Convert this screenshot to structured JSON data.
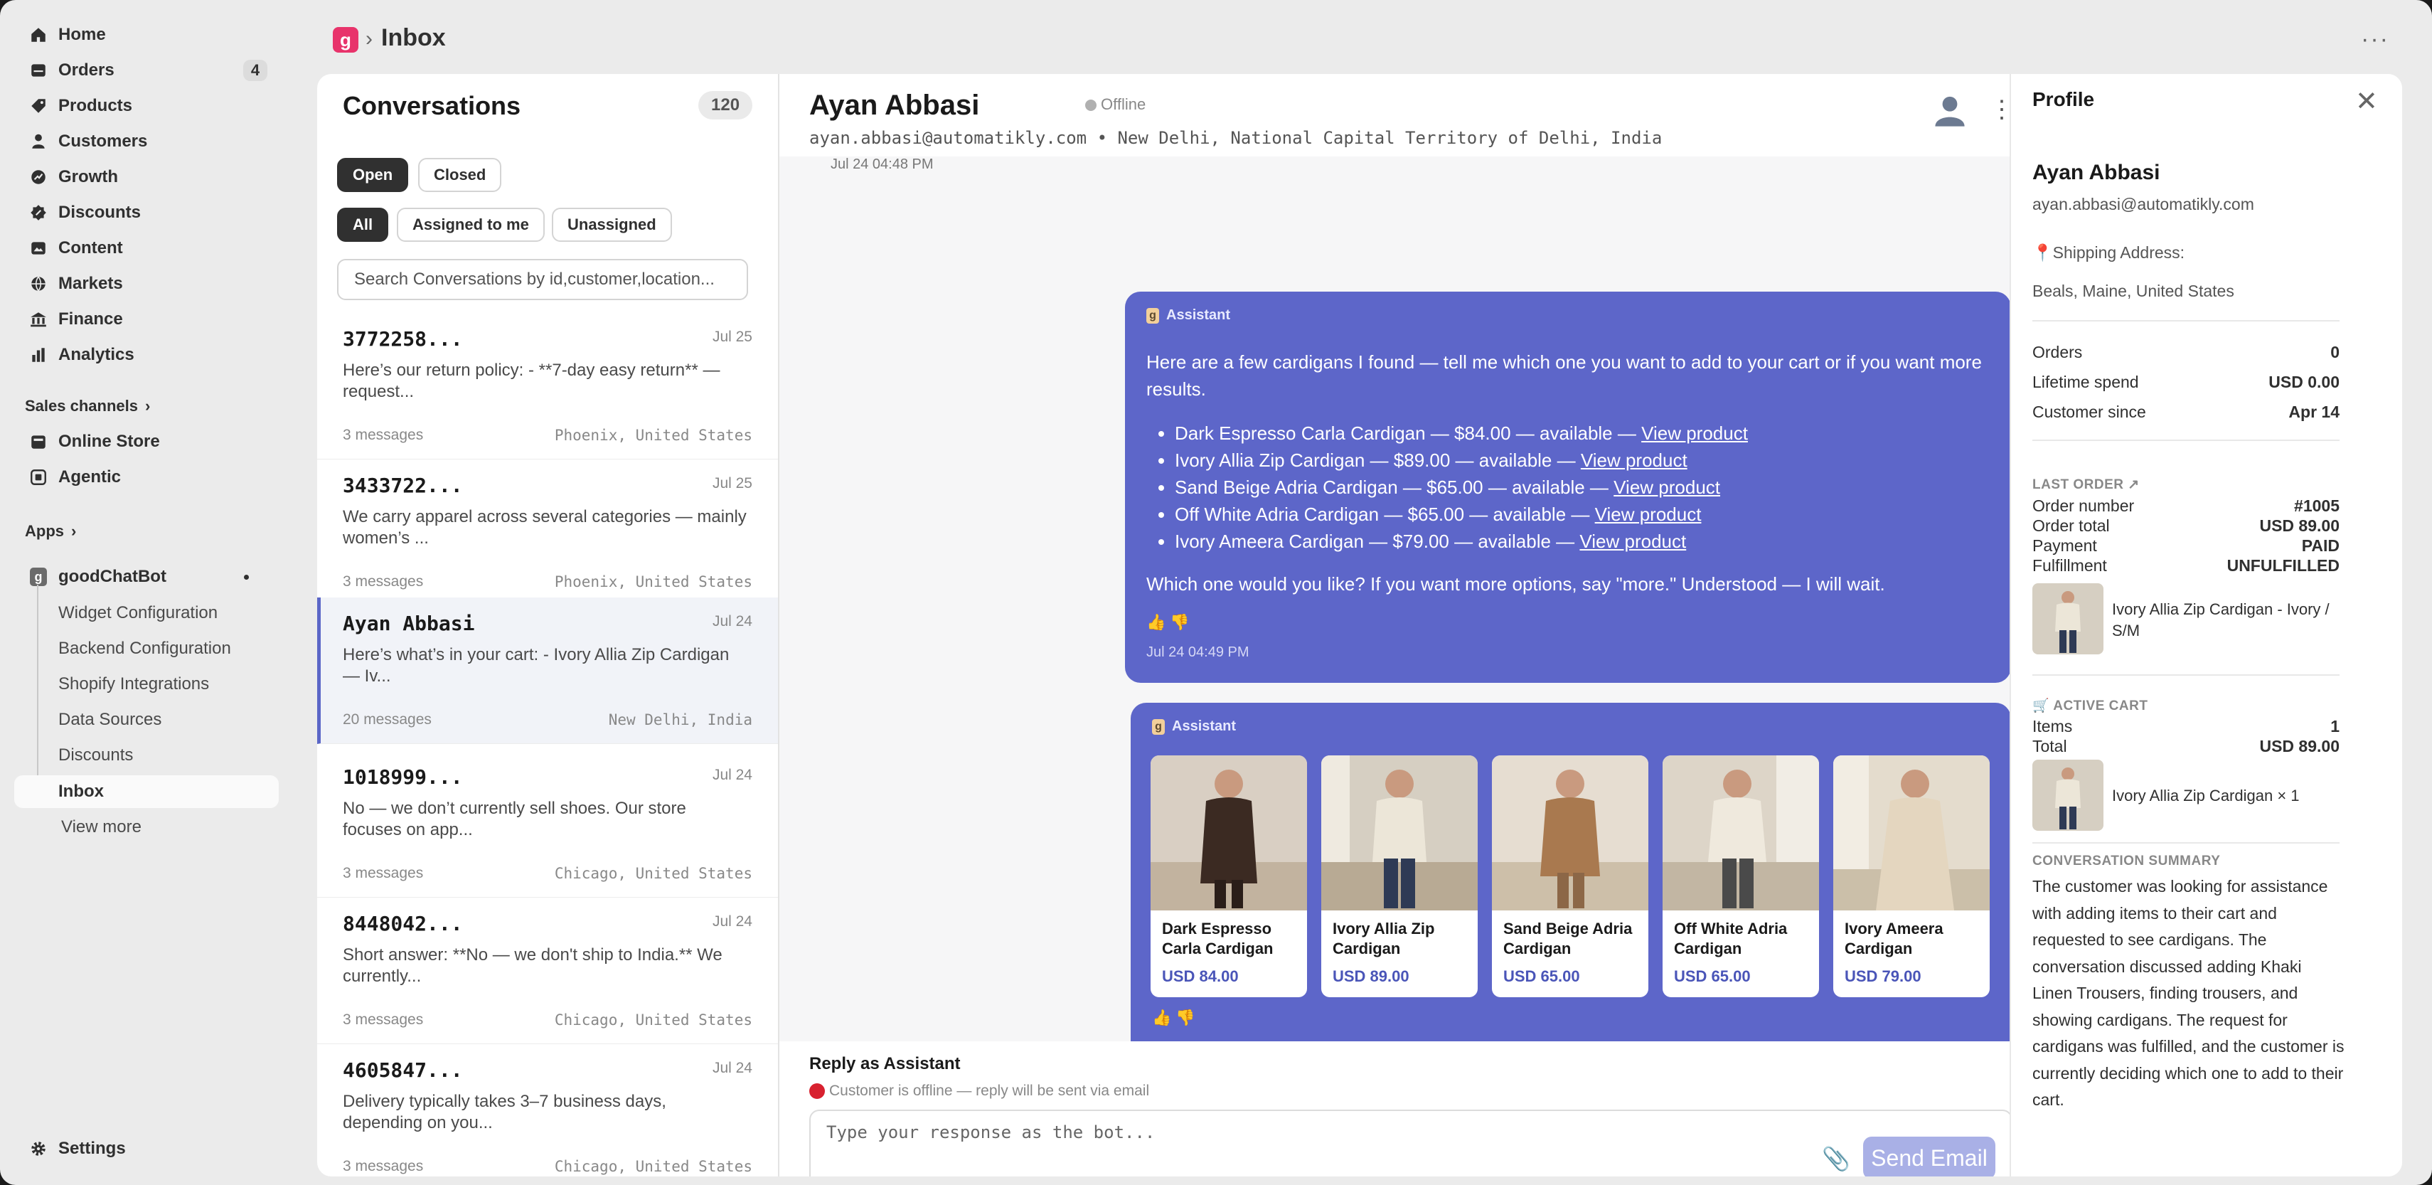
{
  "sidebar": {
    "nav": [
      {
        "label": "Home",
        "icon": "home-icon"
      },
      {
        "label": "Orders",
        "icon": "orders-icon",
        "badge": "4"
      },
      {
        "label": "Products",
        "icon": "tag-icon"
      },
      {
        "label": "Customers",
        "icon": "person-icon"
      },
      {
        "label": "Growth",
        "icon": "growth-icon"
      },
      {
        "label": "Discounts",
        "icon": "discount-icon"
      },
      {
        "label": "Content",
        "icon": "content-icon"
      },
      {
        "label": "Markets",
        "icon": "globe-icon"
      },
      {
        "label": "Finance",
        "icon": "bank-icon"
      },
      {
        "label": "Analytics",
        "icon": "bar-chart-icon"
      }
    ],
    "sales_channels_label": "Sales channels",
    "channels": [
      {
        "label": "Online Store",
        "icon": "store-icon"
      },
      {
        "label": "Agentic",
        "icon": "agentic-icon"
      }
    ],
    "apps_label": "Apps",
    "app_name": "goodChatBot",
    "app_sub": [
      "Widget Configuration",
      "Backend Configuration",
      "Shopify Integrations",
      "Data Sources",
      "Discounts",
      "Inbox"
    ],
    "view_more": "View more",
    "settings": "Settings"
  },
  "topbar": {
    "brand": "g",
    "separator": "›",
    "title": "Inbox",
    "more": "···"
  },
  "conversations": {
    "title": "Conversations",
    "count": "120",
    "status_filters": [
      "Open",
      "Closed"
    ],
    "assign_filters": [
      "All",
      "Assigned to me",
      "Unassigned"
    ],
    "search_placeholder": "Search Conversations by id,customer,location...",
    "items": [
      {
        "id": "3772258...",
        "date": "Jul 25",
        "text": "Here’s our return policy: - **7-day easy return** — request...",
        "count": "3 messages",
        "loc": "Phoenix, United States"
      },
      {
        "id": "3433722...",
        "date": "Jul 25",
        "text": "We carry apparel across several categories — mainly women’s ...",
        "count": "3 messages",
        "loc": "Phoenix, United States"
      },
      {
        "id": "Ayan Abbasi",
        "date": "Jul 24",
        "text": "Here’s what’s in your cart: - Ivory Allia Zip Cardigan — Iv...",
        "count": "20 messages",
        "loc": "New Delhi, India"
      },
      {
        "id": "1018999...",
        "date": "Jul 24",
        "text": "No — we don’t currently sell shoes. Our store focuses on app...",
        "count": "3 messages",
        "loc": "Chicago, United States"
      },
      {
        "id": "8448042...",
        "date": "Jul 24",
        "text": "Short answer: **No — we don't ship to India.** We currently...",
        "count": "3 messages",
        "loc": "Chicago, United States"
      },
      {
        "id": "4605847...",
        "date": "Jul 24",
        "text": "Delivery typically takes 3–7 business days, depending on you...",
        "count": "3 messages",
        "loc": "Chicago, United States"
      }
    ]
  },
  "chat": {
    "name": "Ayan Abbasi",
    "status": "Offline",
    "subtitle": "ayan.abbasi@automatikly.com • New Delhi, National Capital Territory of Delhi, India",
    "top_timestamp": "Jul 24 04:48 PM",
    "msg1": {
      "sender": "Assistant",
      "intro": "Here are a few cardigans I found — tell me which one you want to add to your cart or if you want more results.",
      "items": [
        {
          "text": "Dark Espresso Carla Cardigan — $84.00 — available — ",
          "link": "View product"
        },
        {
          "text": "Ivory Allia Zip Cardigan — $89.00 — available — ",
          "link": "View product"
        },
        {
          "text": "Sand Beige Adria Cardigan — $65.00 — available — ",
          "link": "View product"
        },
        {
          "text": "Off White Adria Cardigan — $65.00 — available — ",
          "link": "View product"
        },
        {
          "text": "Ivory Ameera Cardigan — $79.00 — available — ",
          "link": "View product"
        }
      ],
      "outro": "Which one would you like? If you want more options, say \"more.\" Understood — I will wait.",
      "time": "Jul 24 04:49 PM"
    },
    "msg2": {
      "sender": "Assistant",
      "products": [
        {
          "name": "Dark Espresso Carla Cardigan",
          "price": "USD 84.00",
          "color": "#3b2a22"
        },
        {
          "name": "Ivory Allia Zip Cardigan",
          "price": "USD 89.00",
          "color": "#ece6d8"
        },
        {
          "name": "Sand Beige Adria Cardigan",
          "price": "USD 65.00",
          "color": "#a9794f"
        },
        {
          "name": "Off White Adria Cardigan",
          "price": "USD 65.00",
          "color": "#efe9dd"
        },
        {
          "name": "Ivory Ameera Cardigan",
          "price": "USD 79.00",
          "color": "#e4d6bf"
        }
      ]
    },
    "reply_title": "Reply as Assistant",
    "offline_note": "Customer is offline — reply will be sent via email",
    "reply_placeholder": "Type your response as the bot...",
    "send_label": "Send Email"
  },
  "profile": {
    "title": "Profile",
    "name": "Ayan Abbasi",
    "email": "ayan.abbasi@automatikly.com",
    "shipping_label": "📍Shipping Address:",
    "address": "Beals, Maine, United States",
    "stats": [
      {
        "k": "Orders",
        "v": "0"
      },
      {
        "k": "Lifetime spend",
        "v": "USD 0.00"
      },
      {
        "k": "Customer since",
        "v": "Apr 14"
      }
    ],
    "last_order_label": "LAST ORDER ↗",
    "last_order": [
      {
        "k": "Order number",
        "v": "#1005"
      },
      {
        "k": "Order total",
        "v": "USD 89.00"
      },
      {
        "k": "Payment",
        "v": "PAID"
      },
      {
        "k": "Fulfillment",
        "v": "UNFULFILLED"
      }
    ],
    "last_order_item": "Ivory Allia Zip Cardigan - Ivory / S/M",
    "active_cart_label": "🛒 ACTIVE CART",
    "cart": [
      {
        "k": "Items",
        "v": "1"
      },
      {
        "k": "Total",
        "v": "USD 89.00"
      }
    ],
    "cart_item": "Ivory Allia Zip Cardigan × 1",
    "summary_label": "CONVERSATION SUMMARY",
    "summary": "The customer was looking for assistance with adding items to their cart and requested to see cardigans. The conversation discussed adding Khaki Linen Trousers, finding trousers, and showing cardigans. The request for cardigans was fulfilled, and the customer is currently deciding which one to add to their cart."
  }
}
